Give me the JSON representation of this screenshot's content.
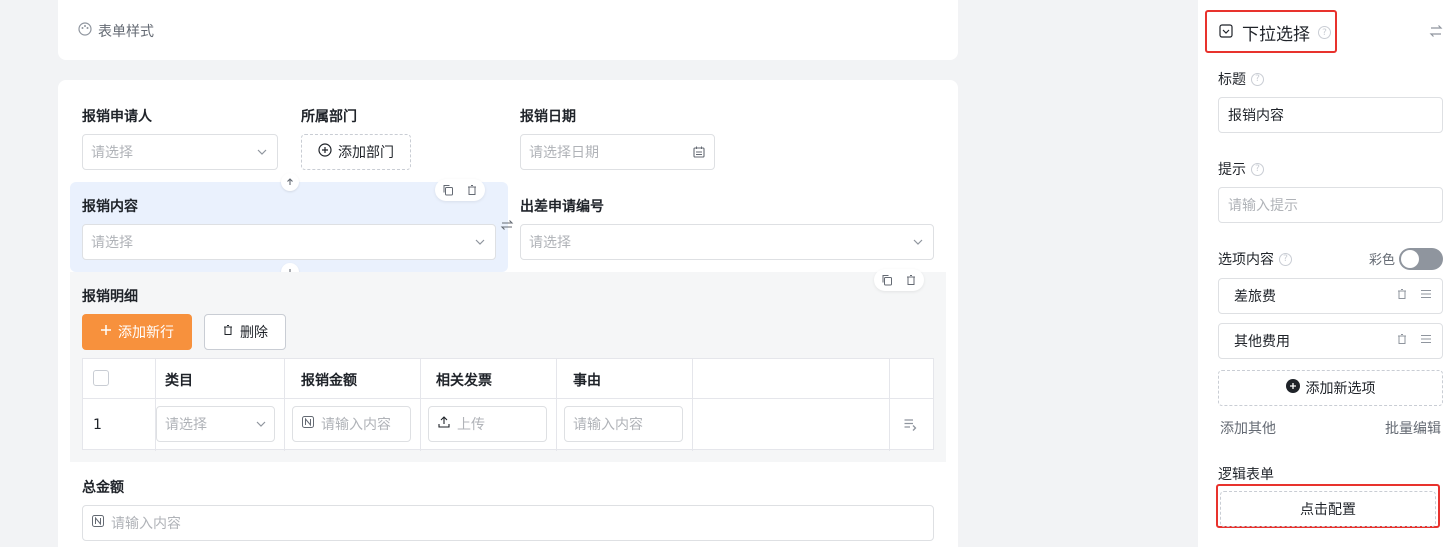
{
  "top_card": {
    "form_style_label": "表单样式"
  },
  "form": {
    "applicant": {
      "label": "报销申请人",
      "placeholder": "请选择"
    },
    "department": {
      "label": "所属部门",
      "button": "添加部门"
    },
    "date": {
      "label": "报销日期",
      "placeholder": "请选择日期"
    },
    "content": {
      "label": "报销内容",
      "placeholder": "请选择"
    },
    "trip_no": {
      "label": "出差申请编号",
      "placeholder": "请选择"
    },
    "detail": {
      "label": "报销明细",
      "add_row": "添加新行",
      "delete": "删除",
      "columns": [
        "类目",
        "报销金额",
        "相关发票",
        "事由"
      ],
      "row_index": "1",
      "row": {
        "category_placeholder": "请选择",
        "amount_placeholder": "请输入内容",
        "invoice_button": "上传",
        "reason_placeholder": "请输入内容"
      }
    },
    "total": {
      "label": "总金额",
      "placeholder": "请输入内容"
    }
  },
  "panel": {
    "title": "下拉选择",
    "title_field": {
      "label": "标题",
      "value": "报销内容"
    },
    "hint_field": {
      "label": "提示",
      "placeholder": "请输入提示"
    },
    "options": {
      "label": "选项内容",
      "color_label": "彩色",
      "color_on": false,
      "items": [
        "差旅费",
        "其他费用"
      ],
      "add_option": "添加新选项",
      "add_other": "添加其他",
      "bulk_edit": "批量编辑"
    },
    "logic": {
      "label": "逻辑表单",
      "configure": "点击配置"
    }
  },
  "colors": {
    "primary_orange": "#f7913d",
    "highlight_red": "#e8322d",
    "selected_bg": "#eaf1fd"
  }
}
